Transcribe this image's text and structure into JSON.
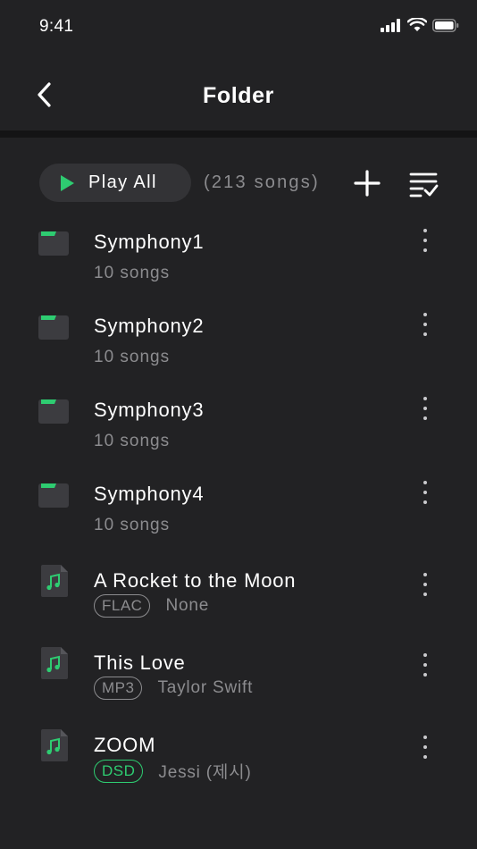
{
  "status_bar": {
    "time": "9:41",
    "icons": [
      "cellular-signal-icon",
      "wifi-icon",
      "battery-icon"
    ]
  },
  "header": {
    "title": "Folder",
    "back_icon": "chevron-left-icon"
  },
  "toolbar": {
    "play_all_label": "Play All",
    "song_count": "(213 songs)",
    "add_icon": "plus-icon",
    "sort_icon": "list-check-icon"
  },
  "folders": [
    {
      "name": "Symphony1",
      "count": "10 songs"
    },
    {
      "name": "Symphony2",
      "count": "10 songs"
    },
    {
      "name": "Symphony3",
      "count": "10 songs"
    },
    {
      "name": "Symphony4",
      "count": "10 songs"
    }
  ],
  "songs": [
    {
      "title": "A Rocket to the Moon",
      "format": "FLAC",
      "artist": "None"
    },
    {
      "title": "This Love",
      "format": "MP3",
      "artist": "Taylor Swift"
    },
    {
      "title": "ZOOM",
      "format": "DSD",
      "artist": "Jessi (제시)"
    }
  ],
  "colors": {
    "background": "#222224",
    "accent": "#2ecc71",
    "muted_text": "#8c8c8f",
    "pill": "#333336"
  }
}
